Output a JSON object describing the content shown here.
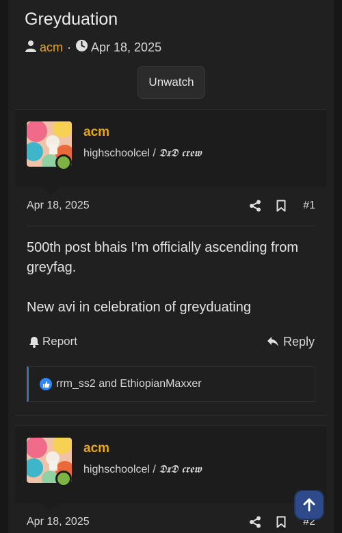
{
  "thread": {
    "title": "Greyduation",
    "author": "acm",
    "separator": "·",
    "date": "Apr 18, 2025",
    "unwatch_label": "Unwatch"
  },
  "posts": [
    {
      "username": "acm",
      "user_title_prefix": "highschoolcel / ",
      "user_title_crew": "𝕯𝖝𝕯 𝖈𝖗𝖊𝖜",
      "date": "Apr 18, 2025",
      "number": "#1",
      "body_line1": "500th post bhais I'm officially ascending from greyfag.",
      "body_line2": "New avi in celebration of greyduating",
      "report_label": "Report",
      "reply_label": "Reply",
      "reactions_text": "rrm_ss2 and EthiopianMaxxer"
    },
    {
      "username": "acm",
      "user_title_prefix": "highschoolcel / ",
      "user_title_crew": "𝕯𝖝𝕯 𝖈𝖗𝖊𝖜",
      "date": "Apr 18, 2025",
      "number": "#2"
    }
  ],
  "colors": {
    "accent": "#e6a817",
    "online": "#7cb342",
    "scroll_button": "#2f4a8a",
    "like": "#2d88ff"
  }
}
